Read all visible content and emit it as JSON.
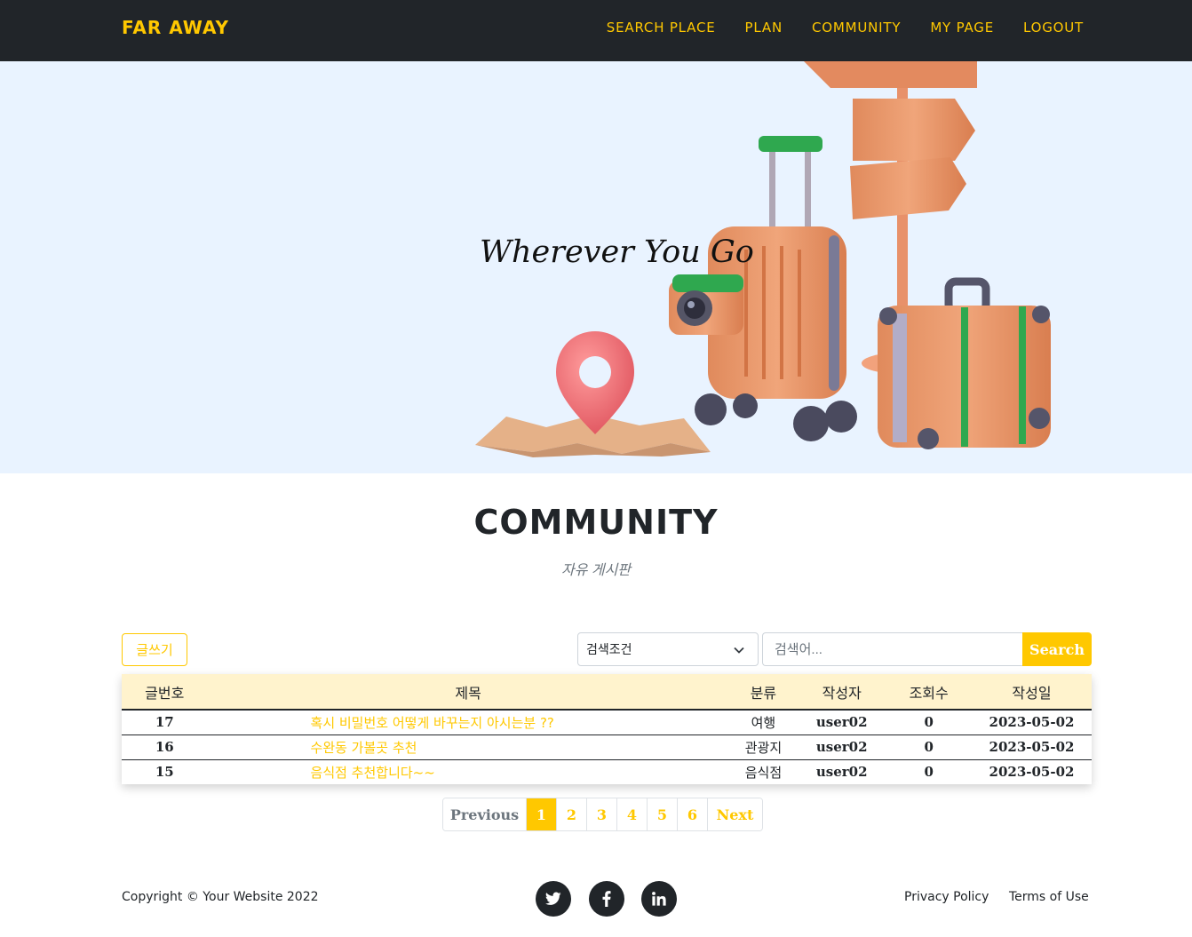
{
  "navbar": {
    "brand": "FAR AWAY",
    "links": [
      "SEARCH PLACE",
      "PLAN",
      "COMMUNITY",
      "MY PAGE",
      "LOGOUT"
    ]
  },
  "hero": {
    "title": "Wherever You Go"
  },
  "section": {
    "heading": "COMMUNITY",
    "subheading": "자유 게시판"
  },
  "controls": {
    "write_label": "글쓰기",
    "select_value": "검색조건",
    "search_placeholder": "검색어...",
    "search_label": "Search"
  },
  "table": {
    "headers": [
      "글번호",
      "제목",
      "분류",
      "작성자",
      "조회수",
      "작성일"
    ],
    "rows": [
      {
        "no": "17",
        "title": "혹시 비밀번호 어떻게 바꾸는지 아시는분 ??",
        "category": "여행",
        "author": "user02",
        "views": "0",
        "date": "2023-05-02"
      },
      {
        "no": "16",
        "title": "수완동 가볼곳 추천",
        "category": "관광지",
        "author": "user02",
        "views": "0",
        "date": "2023-05-02"
      },
      {
        "no": "15",
        "title": "음식점 추천합니다~~",
        "category": "음식점",
        "author": "user02",
        "views": "0",
        "date": "2023-05-02"
      }
    ]
  },
  "pagination": {
    "previous": "Previous",
    "pages": [
      "1",
      "2",
      "3",
      "4",
      "5",
      "6"
    ],
    "active_page": "1",
    "next": "Next"
  },
  "footer": {
    "copyright": "Copyright © Your Website 2022",
    "social_icons": [
      "twitter-icon",
      "facebook-icon",
      "linkedin-icon"
    ],
    "privacy": "Privacy Policy",
    "terms": "Terms of Use"
  },
  "colors": {
    "accent": "#ffc800",
    "navbar": "#212529",
    "hero_bg": "#e9f3ff",
    "table_header_bg": "#fff3cd"
  }
}
